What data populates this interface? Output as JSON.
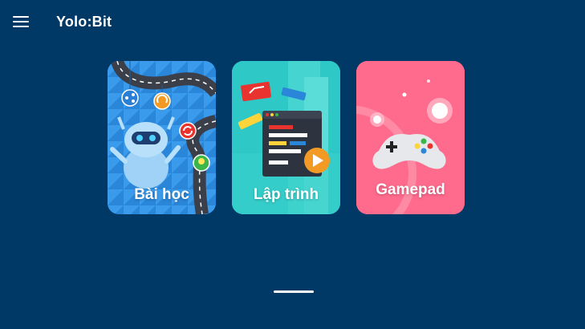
{
  "app": {
    "title": "Yolo:Bit"
  },
  "cards": [
    {
      "label": "Bài học",
      "color": "#2f8fe3"
    },
    {
      "label": "Lập trình",
      "color": "#2ec9c6"
    },
    {
      "label": "Gamepad",
      "color": "#ff6b8d"
    }
  ],
  "icons": {
    "menu": "hamburger-menu-icon",
    "lessons": "robot-road-illustration",
    "coding": "code-window-play-illustration",
    "gamepad": "game-controller-illustration"
  },
  "colors": {
    "background": "#003866",
    "text": "#ffffff"
  }
}
